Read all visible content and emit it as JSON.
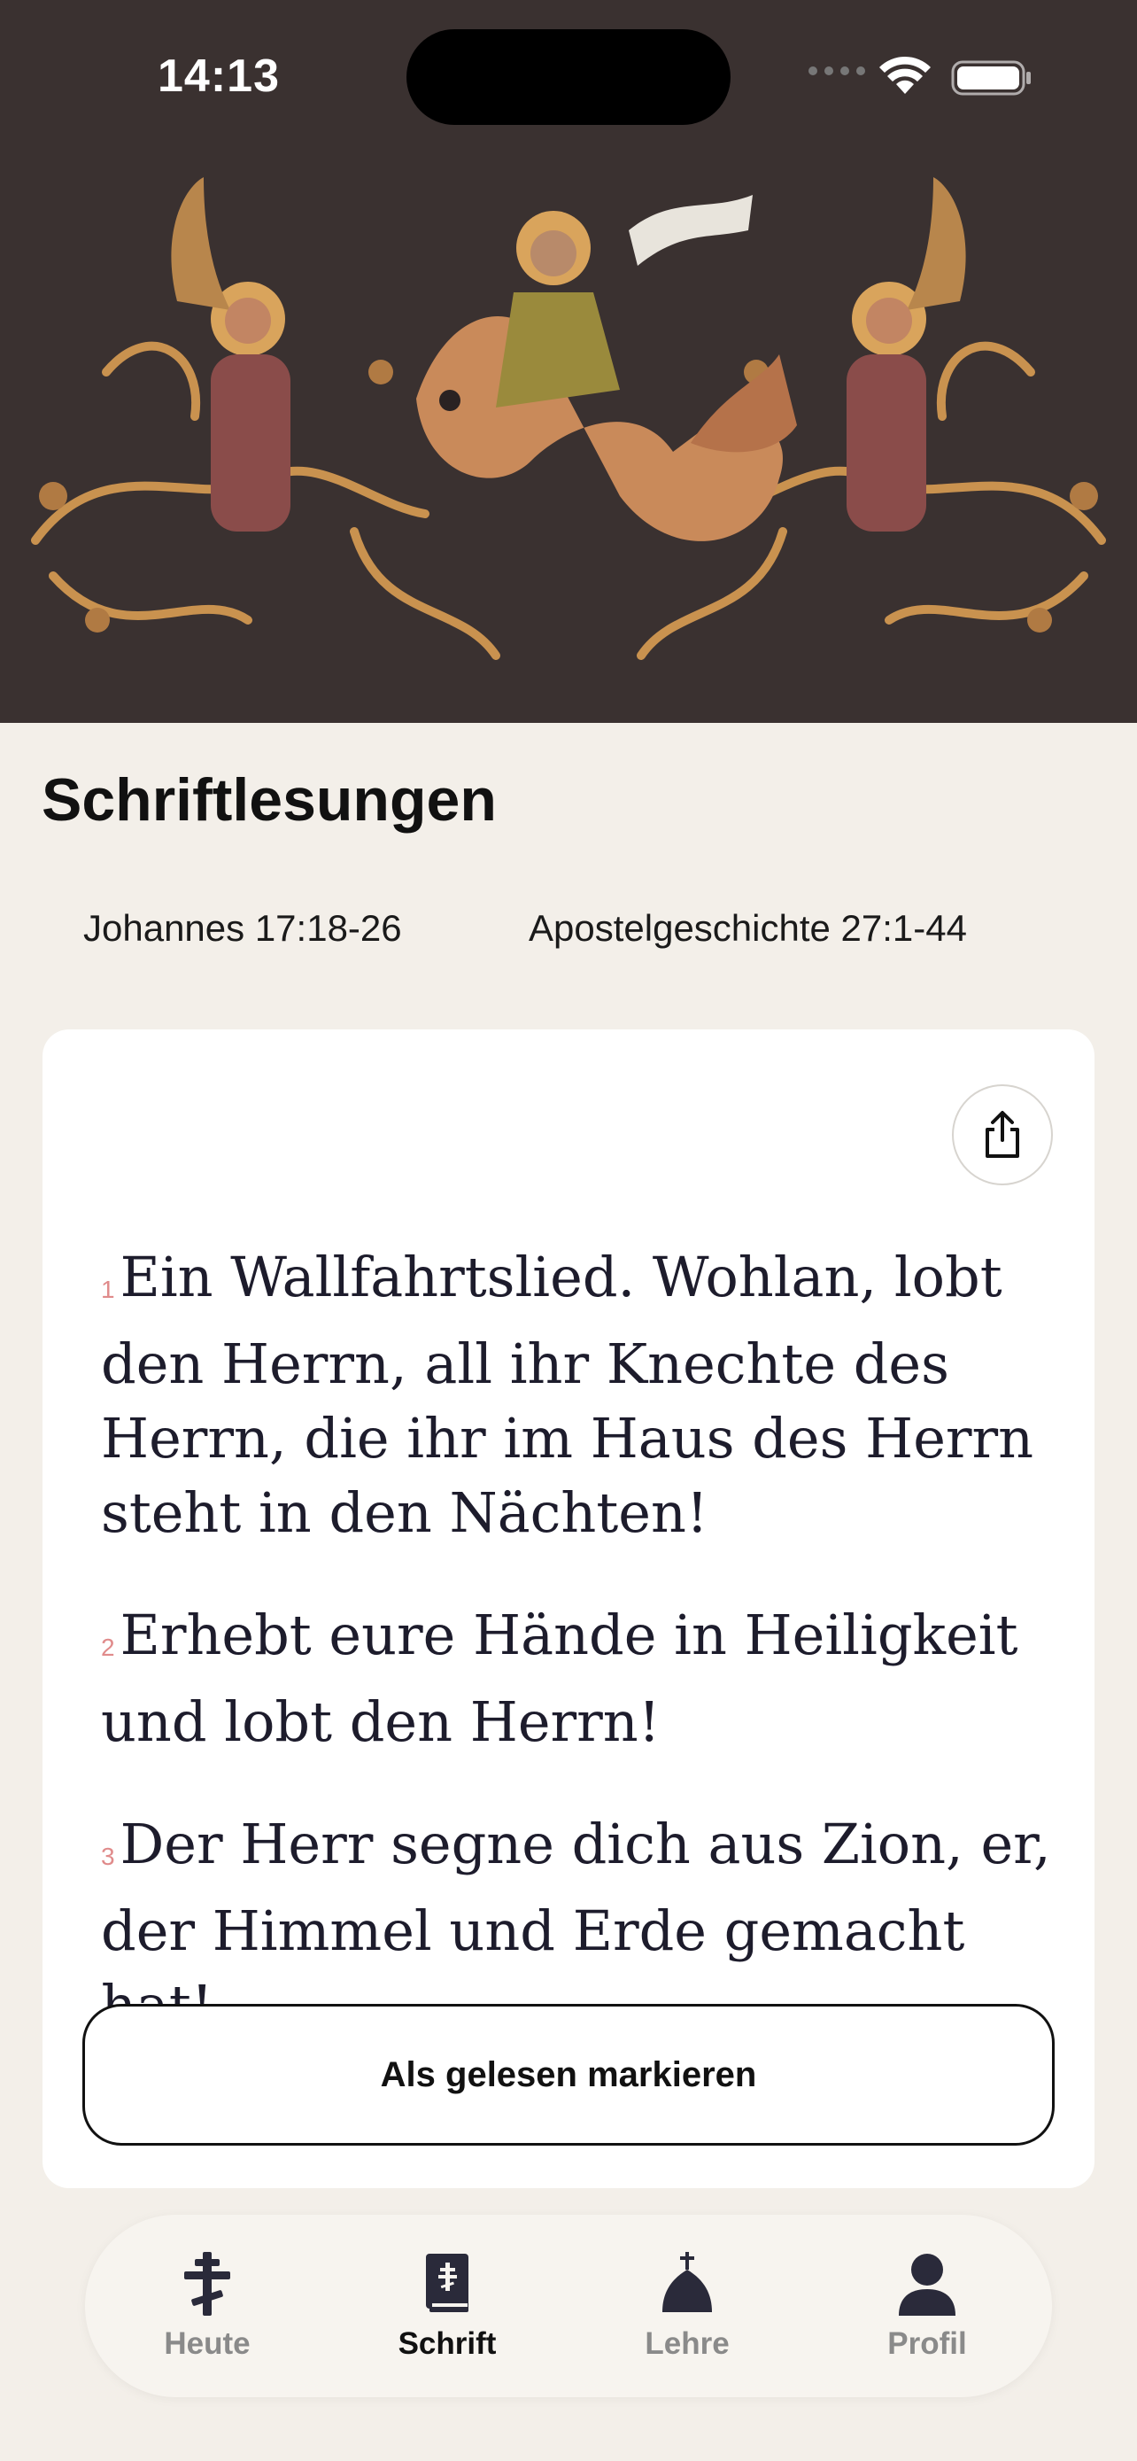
{
  "status_bar": {
    "time": "14:13"
  },
  "page": {
    "title": "Schriftlesungen"
  },
  "readings": [
    {
      "label": "Johannes 17:18-26"
    },
    {
      "label": "Apostelgeschichte 27:1-44"
    }
  ],
  "card": {
    "share_icon": "share-icon",
    "verses": [
      {
        "num": "1",
        "text": "Ein Wallfahrtslied. Wohlan, lobt den Herrn, all ihr Knechte des Herrn, die ihr im Haus des Herrn steht in den Nächten!"
      },
      {
        "num": "2",
        "text": "Erhebt eure Hände in Heiligkeit und lobt den Herrn!"
      },
      {
        "num": "3",
        "text": "Der Herr segne dich aus Zion, er, der Himmel und Erde gemacht hat!"
      }
    ],
    "mark_read_label": "Als gelesen markieren"
  },
  "tab_bar": {
    "items": [
      {
        "label": "Heute",
        "icon": "orthodox-cross-icon",
        "active": false
      },
      {
        "label": "Schrift",
        "icon": "bible-icon",
        "active": true
      },
      {
        "label": "Lehre",
        "icon": "church-dome-icon",
        "active": false
      },
      {
        "label": "Profil",
        "icon": "person-icon",
        "active": false
      }
    ]
  },
  "colors": {
    "hero_bg": "#3a3130",
    "page_bg": "#f3efe9",
    "verse_number": "#e08b8b",
    "text_dark": "#1d1c2c"
  }
}
